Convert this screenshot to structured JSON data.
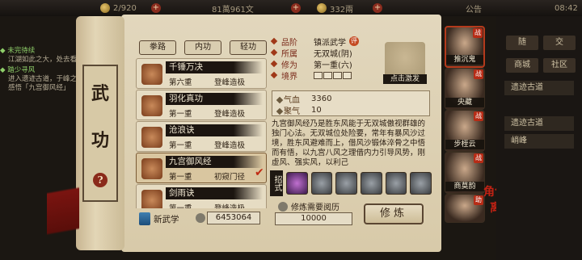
{
  "topbar": {
    "stamina": "2/920",
    "silver": "81萬961文",
    "copper": "332兩",
    "notice": "公告",
    "time": "08:42"
  },
  "quest": [
    {
      "title": "◆ 未完待续",
      "desc": "江湖如此之大，处去看看"
    },
    {
      "title": "◆ 踏少寻风",
      "desc": "进入遗迹古道，于峰之上感悟「九宫御风经」"
    }
  ],
  "scroll": {
    "title_1": "武",
    "title_2": "功",
    "seal": "?"
  },
  "tabs": [
    "拳路",
    "内功",
    "轻功"
  ],
  "skills": [
    {
      "name": "千锤万决",
      "level": "第六重",
      "stage": "登峰造极",
      "checked": false,
      "selected": false
    },
    {
      "name": "羽化真功",
      "level": "第一重",
      "stage": "登峰造极",
      "checked": false,
      "selected": false
    },
    {
      "name": "沧浪诀",
      "level": "第一重",
      "stage": "登峰造极",
      "checked": false,
      "selected": false
    },
    {
      "name": "九宫御风经",
      "level": "第一重",
      "stage": "初窥门径",
      "checked": true,
      "selected": true
    },
    {
      "name": "剑雨诀",
      "level": "第一重",
      "stage": "登峰造极",
      "checked": false,
      "selected": false
    }
  ],
  "bottom": {
    "new_skill": "新武学",
    "points": "6453064",
    "req_label": "修炼需要阅历",
    "req_value": "10000",
    "train": "修炼"
  },
  "detail": {
    "grade_label": "品阶",
    "grade_value": "镇派武学",
    "grade_badge": "评",
    "faction_label": "所属",
    "faction_value": "无双城(阴)",
    "cultivation_label": "修为",
    "cultivation_value": "第一重(六)",
    "realm_label": "境界",
    "figure_label": "点击激发",
    "stats": [
      {
        "k": "气血",
        "v": "3360"
      },
      {
        "k": "聚气",
        "v": "10"
      }
    ],
    "description": "九宫御风经乃是胜东风能于无双城傲视群雄的独门心法。无双城位处险要，常年有暴风沙过境，胜东风避难而上，借风沙锻体淬骨之中悟而有悟，以九宫八风之理借内力引导风势，刚虚风、强实风，以利己",
    "moves_label": "招式"
  },
  "roster": [
    {
      "name": "推沉鬼",
      "badge": "战",
      "spec": "",
      "selected": true
    },
    {
      "name": "央藏",
      "badge": "战",
      "spec": "",
      "selected": false
    },
    {
      "name": "步桎云",
      "badge": "战",
      "spec": "",
      "selected": false
    },
    {
      "name": "商莫韵",
      "badge": "战",
      "spec": "",
      "selected": false
    },
    {
      "name": "",
      "badge": "助",
      "spec": "",
      "selected": false
    }
  ],
  "side_labels": {
    "role": "角色",
    "leave": "离开"
  },
  "rmenu": {
    "b1": "随",
    "b2": "交",
    "b3": "商城",
    "b4": "社区",
    "w1": "遗迹古道",
    "w2": "遗迹古道",
    "w3": "峭峰"
  }
}
